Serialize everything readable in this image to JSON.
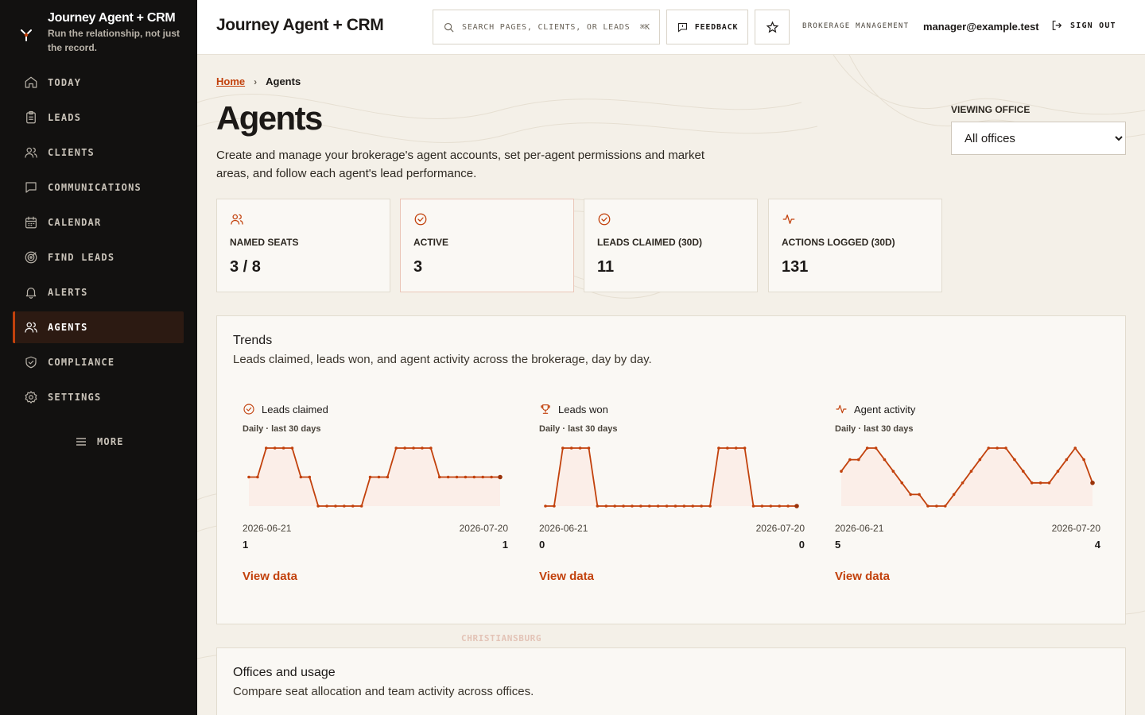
{
  "app": {
    "name": "Journey Agent + CRM",
    "tagline": "Run the relationship, not just the record."
  },
  "sidebar": {
    "items": [
      {
        "label": "TODAY",
        "icon": "home-icon"
      },
      {
        "label": "LEADS",
        "icon": "clipboard-icon"
      },
      {
        "label": "CLIENTS",
        "icon": "users-icon"
      },
      {
        "label": "COMMUNICATIONS",
        "icon": "message-icon"
      },
      {
        "label": "CALENDAR",
        "icon": "calendar-icon"
      },
      {
        "label": "FIND LEADS",
        "icon": "target-icon"
      },
      {
        "label": "ALERTS",
        "icon": "bell-icon"
      },
      {
        "label": "AGENTS",
        "icon": "users-icon",
        "active": true
      },
      {
        "label": "COMPLIANCE",
        "icon": "shield-icon"
      },
      {
        "label": "SETTINGS",
        "icon": "gear-icon"
      }
    ],
    "more_label": "MORE"
  },
  "topbar": {
    "title": "Journey Agent + CRM",
    "search_placeholder": "Search pages, clients, or leads",
    "search_shortcut": "⌘K",
    "feedback_label": "FEEDBACK",
    "role_label": "BROKERAGE MANAGEMENT",
    "user_email": "manager@example.test",
    "signout_label": "SIGN OUT"
  },
  "breadcrumb": {
    "home": "Home",
    "current": "Agents"
  },
  "page": {
    "title": "Agents",
    "description": "Create and manage your brokerage's agent accounts, set per-agent permissions and market areas, and follow each agent's lead performance."
  },
  "office_filter": {
    "label": "VIEWING OFFICE",
    "selected": "All offices"
  },
  "stats": [
    {
      "label": "NAMED SEATS",
      "value": "3 / 8",
      "icon": "users-icon"
    },
    {
      "label": "ACTIVE",
      "value": "3",
      "icon": "check-circle-icon"
    },
    {
      "label": "LEADS CLAIMED (30D)",
      "value": "11",
      "icon": "check-circle-icon"
    },
    {
      "label": "ACTIONS LOGGED (30D)",
      "value": "131",
      "icon": "activity-icon"
    }
  ],
  "trends": {
    "title": "Trends",
    "subtitle": "Leads claimed, leads won, and agent activity across the brokerage, day by day.",
    "view_data_label": "View data"
  },
  "chart_data": [
    {
      "type": "line",
      "title": "Leads claimed",
      "subtitle": "Daily · last 30 days",
      "x_start": "2026-06-21",
      "x_end": "2026-07-20",
      "first_value": "1",
      "last_value": "1",
      "values": [
        1,
        1,
        2,
        2,
        2,
        2,
        1,
        1,
        0,
        0,
        0,
        0,
        0,
        0,
        1,
        1,
        1,
        2,
        2,
        2,
        2,
        2,
        1,
        1,
        1,
        1,
        1,
        1,
        1,
        1
      ],
      "ylim": [
        0,
        2
      ],
      "color": "#c2410c"
    },
    {
      "type": "line",
      "title": "Leads won",
      "subtitle": "Daily · last 30 days",
      "x_start": "2026-06-21",
      "x_end": "2026-07-20",
      "first_value": "0",
      "last_value": "0",
      "values": [
        0,
        0,
        1,
        1,
        1,
        1,
        0,
        0,
        0,
        0,
        0,
        0,
        0,
        0,
        0,
        0,
        0,
        0,
        0,
        0,
        1,
        1,
        1,
        1,
        0,
        0,
        0,
        0,
        0,
        0
      ],
      "ylim": [
        0,
        1
      ],
      "color": "#c2410c"
    },
    {
      "type": "line",
      "title": "Agent activity",
      "subtitle": "Daily · last 30 days",
      "x_start": "2026-06-21",
      "x_end": "2026-07-20",
      "first_value": "5",
      "last_value": "4",
      "values": [
        5,
        6,
        6,
        7,
        7,
        6,
        5,
        4,
        3,
        3,
        2,
        2,
        2,
        3,
        4,
        5,
        6,
        7,
        7,
        7,
        6,
        5,
        4,
        4,
        4,
        5,
        6,
        7,
        6,
        4
      ],
      "ylim": [
        2,
        7
      ],
      "color": "#c2410c"
    }
  ],
  "offices": {
    "title": "Offices and usage",
    "subtitle": "Compare seat allocation and team activity across offices."
  },
  "map_labels": [
    "CHRISTIANSBURG"
  ]
}
